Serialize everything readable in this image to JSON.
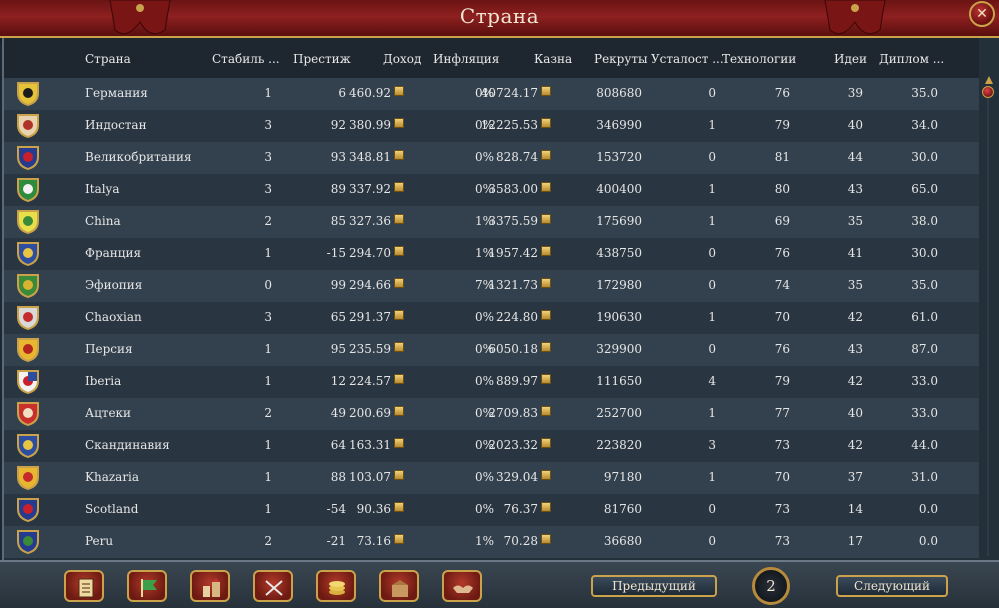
{
  "window": {
    "title": "Страна",
    "close_glyph": "✕"
  },
  "columns": [
    "Страна",
    "Стабиль ...",
    "Престиж",
    "Доход",
    "Инфляция",
    "Казна",
    "Рекруты",
    "Усталост ...",
    "Технологии",
    "Идеи",
    "Диплом ..."
  ],
  "rows": [
    {
      "country": "Германия",
      "stability": "1",
      "prestige": "6",
      "income": "460.92",
      "inflation": "0%",
      "treasury": "40724.17",
      "manpower": "808680",
      "war_exhaustion": "0",
      "technology": "76",
      "ideas": "39",
      "diplomacy": "35.0",
      "flag_colors": [
        "#e4c23a",
        "#1b1b1b"
      ]
    },
    {
      "country": "Индостан",
      "stability": "3",
      "prestige": "92",
      "income": "380.99",
      "inflation": "0%",
      "treasury": "12225.53",
      "manpower": "346990",
      "war_exhaustion": "1",
      "technology": "79",
      "ideas": "40",
      "diplomacy": "34.0",
      "flag_colors": [
        "#e7d3b0",
        "#b0332a"
      ]
    },
    {
      "country": "Великобритания",
      "stability": "3",
      "prestige": "93",
      "income": "348.81",
      "inflation": "0%",
      "treasury": "828.74",
      "manpower": "153720",
      "war_exhaustion": "0",
      "technology": "81",
      "ideas": "44",
      "diplomacy": "30.0",
      "flag_colors": [
        "#243b8f",
        "#c8202c"
      ]
    },
    {
      "country": "Italya",
      "stability": "3",
      "prestige": "89",
      "income": "337.92",
      "inflation": "0%",
      "treasury": "3583.00",
      "manpower": "400400",
      "war_exhaustion": "1",
      "technology": "80",
      "ideas": "43",
      "diplomacy": "65.0",
      "flag_colors": [
        "#2e8b3e",
        "#f2f2f2"
      ]
    },
    {
      "country": "China",
      "stability": "2",
      "prestige": "85",
      "income": "327.36",
      "inflation": "1%",
      "treasury": "3375.59",
      "manpower": "175690",
      "war_exhaustion": "1",
      "technology": "69",
      "ideas": "35",
      "diplomacy": "38.0",
      "flag_colors": [
        "#e8e04a",
        "#3a8a3a"
      ]
    },
    {
      "country": "Франция",
      "stability": "1",
      "prestige": "-15",
      "income": "294.70",
      "inflation": "1%",
      "treasury": "1957.42",
      "manpower": "438750",
      "war_exhaustion": "0",
      "technology": "76",
      "ideas": "41",
      "diplomacy": "30.0",
      "flag_colors": [
        "#2d4da0",
        "#e8c445"
      ]
    },
    {
      "country": "Эфиопия",
      "stability": "0",
      "prestige": "99",
      "income": "294.66",
      "inflation": "7%",
      "treasury": "1321.73",
      "manpower": "172980",
      "war_exhaustion": "0",
      "technology": "74",
      "ideas": "35",
      "diplomacy": "35.0",
      "flag_colors": [
        "#3b8a3a",
        "#d6b431"
      ]
    },
    {
      "country": "Chaoxian",
      "stability": "3",
      "prestige": "65",
      "income": "291.37",
      "inflation": "0%",
      "treasury": "224.80",
      "manpower": "190630",
      "war_exhaustion": "1",
      "technology": "70",
      "ideas": "42",
      "diplomacy": "61.0",
      "flag_colors": [
        "#d9d9d9",
        "#c42b2b"
      ]
    },
    {
      "country": "Персия",
      "stability": "1",
      "prestige": "95",
      "income": "235.59",
      "inflation": "0%",
      "treasury": "6050.18",
      "manpower": "329900",
      "war_exhaustion": "0",
      "technology": "76",
      "ideas": "43",
      "diplomacy": "87.0",
      "flag_colors": [
        "#e8b630",
        "#b3261e"
      ]
    },
    {
      "country": "Iberia",
      "stability": "1",
      "prestige": "12",
      "income": "224.57",
      "inflation": "0%",
      "treasury": "889.97",
      "manpower": "111650",
      "war_exhaustion": "4",
      "technology": "79",
      "ideas": "42",
      "diplomacy": "33.0",
      "flag_colors": [
        "#f2f2f2",
        "#c8202c",
        "#2d4da0"
      ]
    },
    {
      "country": "Ацтеки",
      "stability": "2",
      "prestige": "49",
      "income": "200.69",
      "inflation": "0%",
      "treasury": "2709.83",
      "manpower": "252700",
      "war_exhaustion": "1",
      "technology": "77",
      "ideas": "40",
      "diplomacy": "33.0",
      "flag_colors": [
        "#c9302c",
        "#f0e0c0"
      ]
    },
    {
      "country": "Скандинавия",
      "stability": "1",
      "prestige": "64",
      "income": "163.31",
      "inflation": "0%",
      "treasury": "2023.32",
      "manpower": "223820",
      "war_exhaustion": "3",
      "technology": "73",
      "ideas": "42",
      "diplomacy": "44.0",
      "flag_colors": [
        "#2d4da0",
        "#e8c445"
      ]
    },
    {
      "country": "Khazaria",
      "stability": "1",
      "prestige": "88",
      "income": "103.07",
      "inflation": "0%",
      "treasury": "329.04",
      "manpower": "97180",
      "war_exhaustion": "1",
      "technology": "70",
      "ideas": "37",
      "diplomacy": "31.0",
      "flag_colors": [
        "#e8b630",
        "#c42b2b"
      ]
    },
    {
      "country": "Scotland",
      "stability": "1",
      "prestige": "-54",
      "income": "90.36",
      "inflation": "0%",
      "treasury": "76.37",
      "manpower": "81760",
      "war_exhaustion": "0",
      "technology": "73",
      "ideas": "14",
      "diplomacy": "0.0",
      "flag_colors": [
        "#243b8f",
        "#c8202c"
      ]
    },
    {
      "country": "Peru",
      "stability": "2",
      "prestige": "-21",
      "income": "73.16",
      "inflation": "1%",
      "treasury": "70.28",
      "manpower": "36680",
      "war_exhaustion": "0",
      "technology": "73",
      "ideas": "17",
      "diplomacy": "0.0",
      "flag_colors": [
        "#243b8f",
        "#3b8a3a"
      ]
    }
  ],
  "bottom_tabs": [
    {
      "icon": "ledger-icon"
    },
    {
      "icon": "flag-icon"
    },
    {
      "icon": "buildings-icon"
    },
    {
      "icon": "crossed-swords-icon"
    },
    {
      "icon": "coins-icon"
    },
    {
      "icon": "goods-icon"
    },
    {
      "icon": "handshake-icon"
    }
  ],
  "pagination": {
    "prev_label": "Предыдущий",
    "next_label": "Следующий",
    "page": "2"
  },
  "colors": {
    "accent_gold": "#c9a24a",
    "title_red": "#8e2020"
  }
}
